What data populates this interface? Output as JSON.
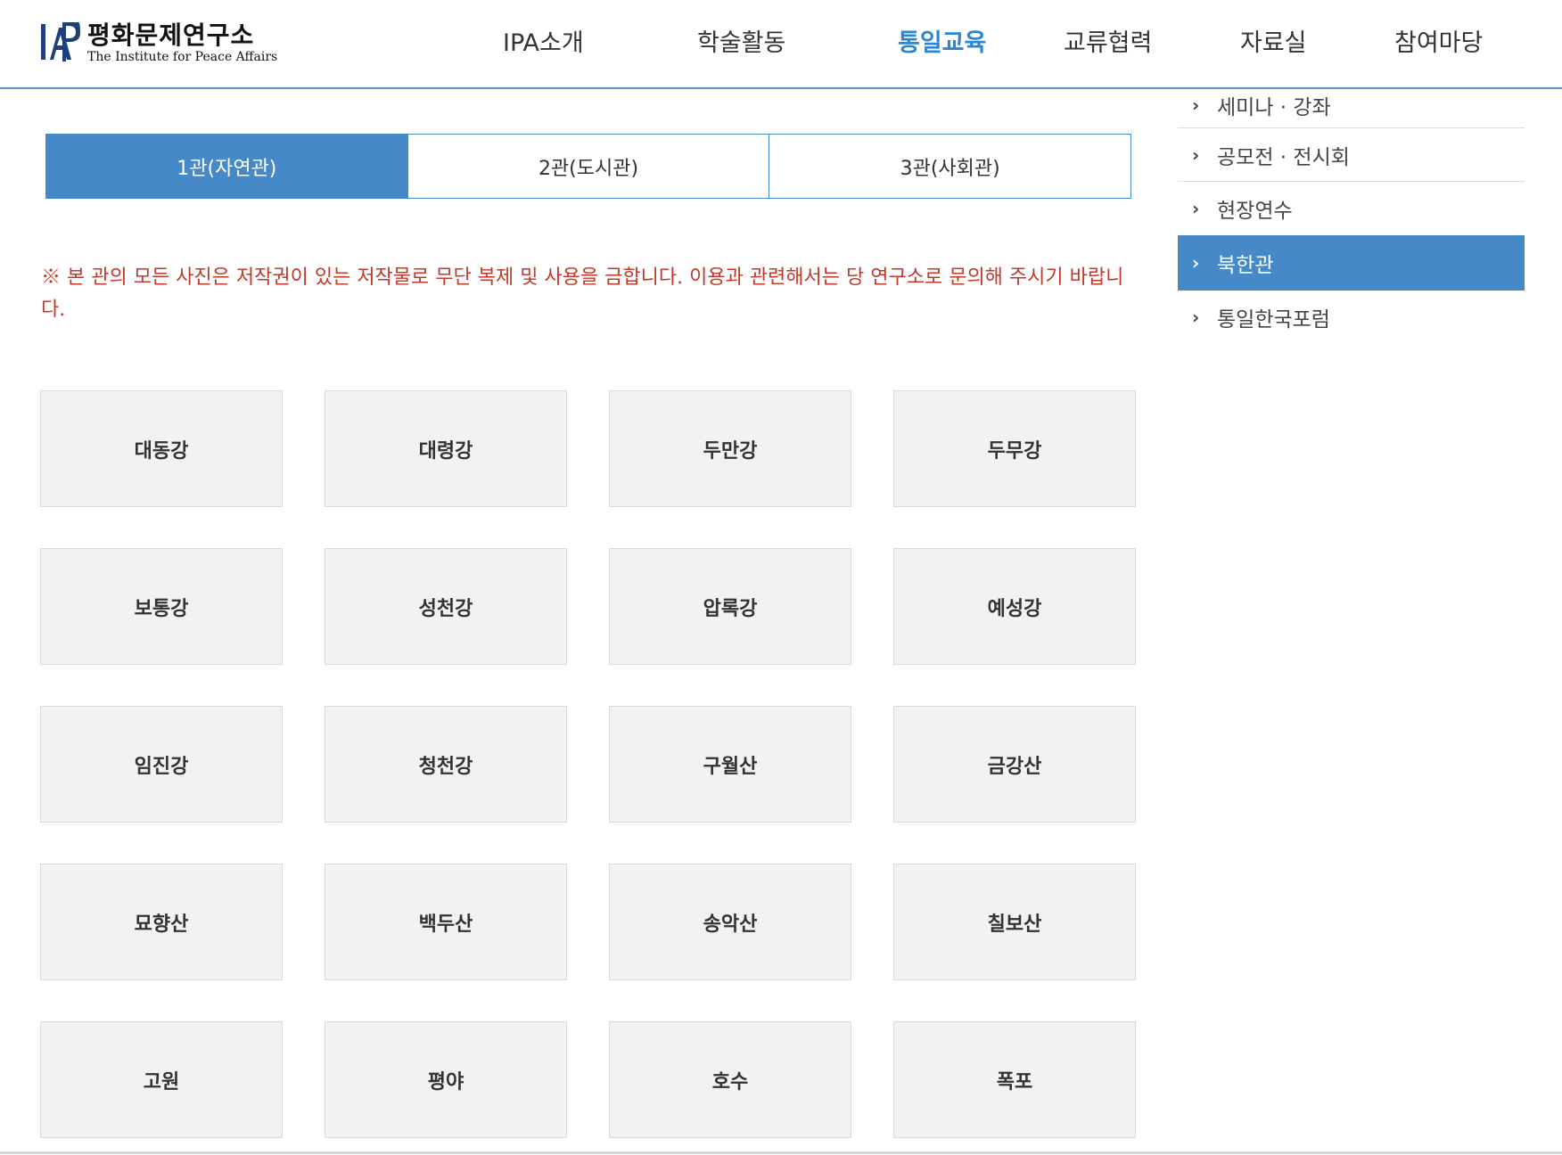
{
  "logo": {
    "ko": "평화문제연구소",
    "en": "The Institute for Peace Affairs",
    "mark": "IAP"
  },
  "gnb": [
    {
      "label": "IPA소개",
      "active": false
    },
    {
      "label": "학술활동",
      "active": false
    },
    {
      "label": "통일교육",
      "active": true
    },
    {
      "label": "교류협력",
      "active": false
    },
    {
      "label": "자료실",
      "active": false
    },
    {
      "label": "참여마당",
      "active": false
    }
  ],
  "tabs": [
    {
      "label": "1관(자연관)",
      "active": true
    },
    {
      "label": "2관(도시관)",
      "active": false
    },
    {
      "label": "3관(사회관)",
      "active": false
    }
  ],
  "notice": "※ 본 관의 모든 사진은 저작권이 있는 저작물로 무단 복제 및 사용을 금합니다. 이용과 관련해서는 당 연구소로 문의해 주시기 바랍니다.",
  "grid": [
    "대동강",
    "대령강",
    "두만강",
    "두무강",
    "보통강",
    "성천강",
    "압록강",
    "예성강",
    "임진강",
    "청천강",
    "구월산",
    "금강산",
    "묘향산",
    "백두산",
    "송악산",
    "칠보산",
    "고원",
    "평야",
    "호수",
    "폭포"
  ],
  "side_menu": [
    {
      "label": "세미나 · 강좌",
      "active": false
    },
    {
      "label": "공모전 · 전시회",
      "active": false
    },
    {
      "label": "현장연수",
      "active": false
    },
    {
      "label": "북한관",
      "active": true
    },
    {
      "label": "통일한국포럼",
      "active": false
    }
  ],
  "icons": {
    "side_arrow": "chevron-right-icon"
  },
  "colors": {
    "accent": "#4589c8",
    "active_nav": "#2c86d6",
    "notice": "#c0392b",
    "cell_bg": "#f2f2f4"
  }
}
